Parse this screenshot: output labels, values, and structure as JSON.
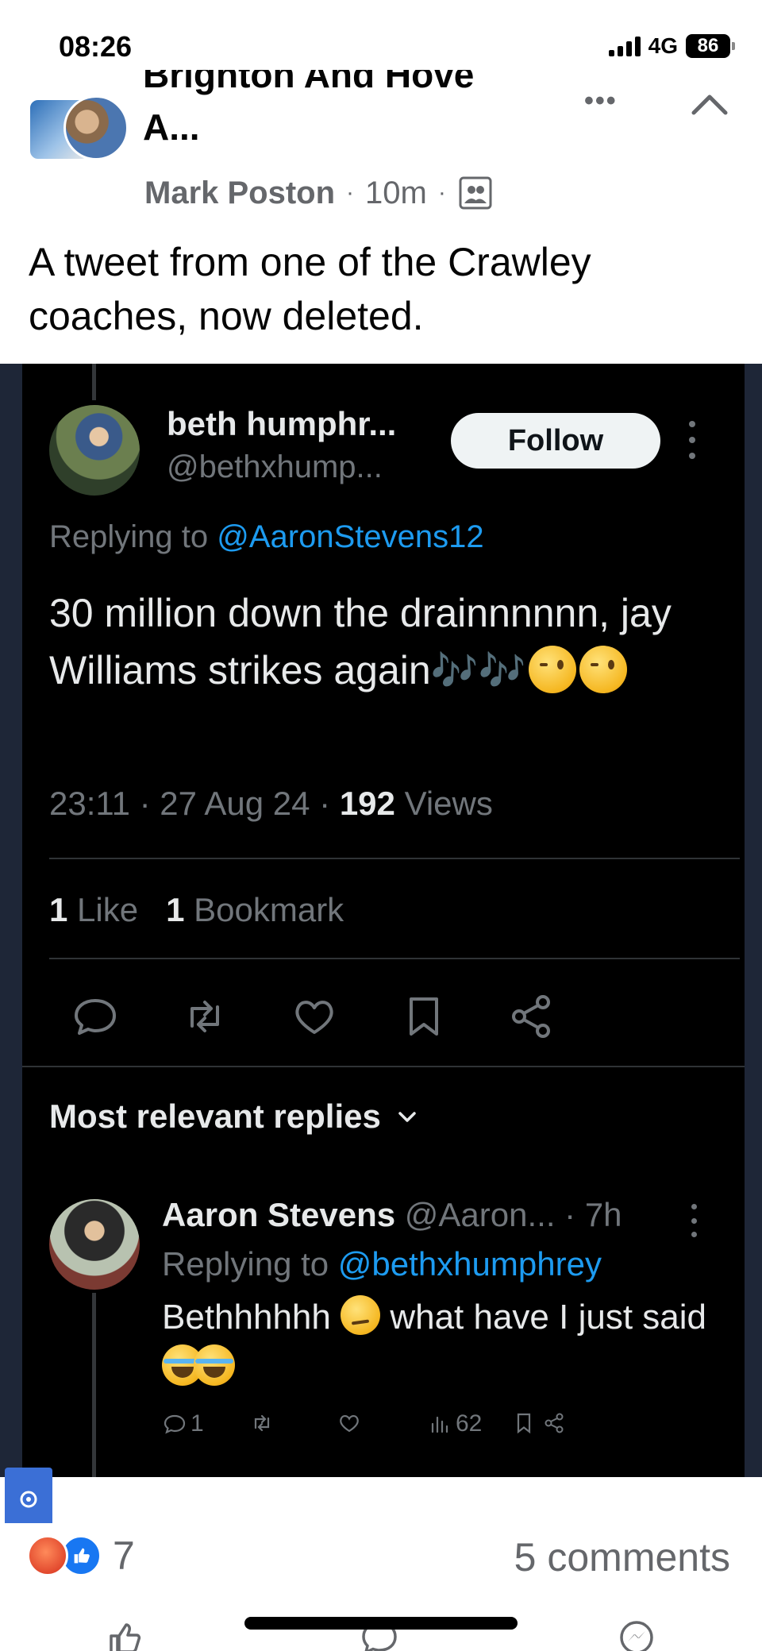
{
  "status_bar": {
    "time": "08:26",
    "network": "4G",
    "battery": "86"
  },
  "post": {
    "group_name_cut": "Brighton And Hove",
    "group_name_line2": "A...",
    "author": "Mark Poston",
    "time_ago": "10m",
    "text": "A tweet from one of the Crawley coaches, now deleted."
  },
  "tweet": {
    "display_name": "beth humphr...",
    "handle": "@bethxhump...",
    "follow_label": "Follow",
    "replying_prefix": "Replying to ",
    "replying_to": "@AaronStevens12",
    "body_text": "30 million down the drainnnnnn, jay Williams strikes again",
    "body_emoji": "🎶🎶",
    "time_date": "23:11 · 27 Aug 24 · ",
    "views_count": "192",
    "views_label": " Views",
    "likes_count": "1",
    "likes_label": " Like",
    "bookmarks_count": "1",
    "bookmarks_label": " Bookmark"
  },
  "replies": {
    "header": "Most relevant replies",
    "items": [
      {
        "name": "Aaron Stevens",
        "handle_time": " @Aaron... · 7h",
        "replying_prefix": "Replying to ",
        "replying_to": "@bethxhumphrey",
        "text_a": "Bethhhhhh ",
        "text_b": " what have I just said",
        "reply_count": "1",
        "views_count": "62"
      }
    ]
  },
  "footer": {
    "reaction_count": "7",
    "comments": "5 comments"
  },
  "colors": {
    "x_background": "#000000",
    "x_link": "#1d9bf0",
    "fb_blue": "#1877f2"
  }
}
